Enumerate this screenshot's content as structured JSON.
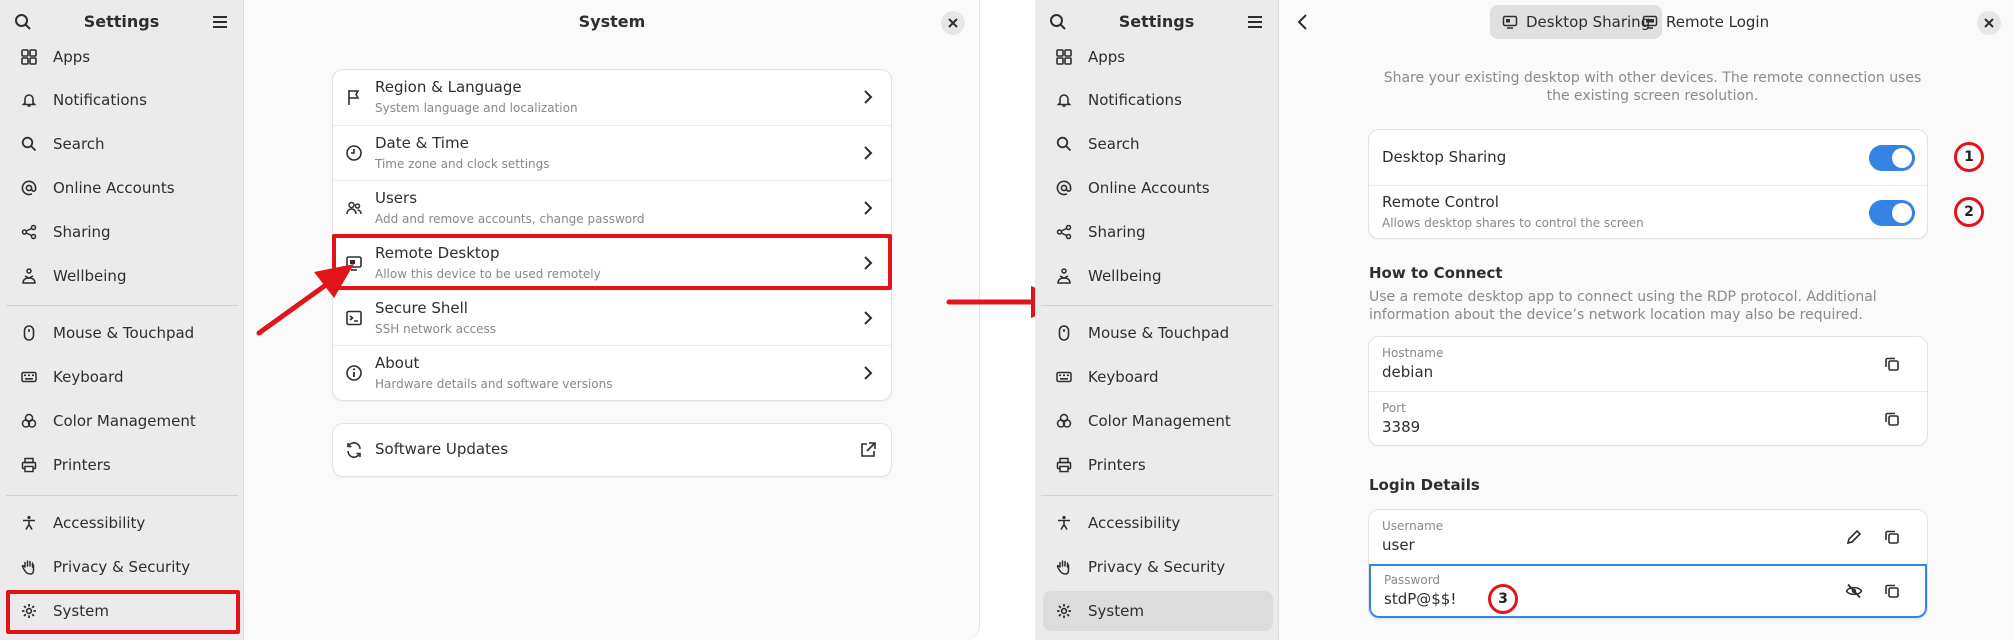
{
  "left_window": {
    "sidebar": {
      "title": "Settings",
      "items": [
        {
          "label": "Apps",
          "icon": "apps-icon"
        },
        {
          "label": "Notifications",
          "icon": "bell-icon"
        },
        {
          "label": "Search",
          "icon": "search-icon"
        },
        {
          "label": "Online Accounts",
          "icon": "at-icon"
        },
        {
          "label": "Sharing",
          "icon": "share-icon"
        },
        {
          "label": "Wellbeing",
          "icon": "wellbeing-icon"
        },
        {
          "label": "Mouse & Touchpad",
          "icon": "mouse-icon"
        },
        {
          "label": "Keyboard",
          "icon": "keyboard-icon"
        },
        {
          "label": "Color Management",
          "icon": "color-icon"
        },
        {
          "label": "Printers",
          "icon": "printer-icon"
        },
        {
          "label": "Accessibility",
          "icon": "accessibility-icon"
        },
        {
          "label": "Privacy & Security",
          "icon": "hand-icon"
        },
        {
          "label": "System",
          "icon": "gear-icon"
        }
      ]
    },
    "page_title": "System",
    "rows": [
      {
        "title": "Region & Language",
        "subtitle": "System language and localization",
        "icon": "flag-icon"
      },
      {
        "title": "Date & Time",
        "subtitle": "Time zone and clock settings",
        "icon": "clock-icon"
      },
      {
        "title": "Users",
        "subtitle": "Add and remove accounts, change password",
        "icon": "users-icon"
      },
      {
        "title": "Remote Desktop",
        "subtitle": "Allow this device to be used remotely",
        "icon": "remote-desktop-icon"
      },
      {
        "title": "Secure Shell",
        "subtitle": "SSH network access",
        "icon": "terminal-icon"
      },
      {
        "title": "About",
        "subtitle": "Hardware details and software versions",
        "icon": "info-icon"
      }
    ],
    "software_updates": "Software Updates"
  },
  "right_window": {
    "sidebar": {
      "title": "Settings",
      "items": [
        {
          "label": "Apps"
        },
        {
          "label": "Notifications"
        },
        {
          "label": "Search"
        },
        {
          "label": "Online Accounts"
        },
        {
          "label": "Sharing"
        },
        {
          "label": "Wellbeing"
        },
        {
          "label": "Mouse & Touchpad"
        },
        {
          "label": "Keyboard"
        },
        {
          "label": "Color Management"
        },
        {
          "label": "Printers"
        },
        {
          "label": "Accessibility"
        },
        {
          "label": "Privacy & Security"
        },
        {
          "label": "System"
        }
      ]
    },
    "tabs": [
      {
        "label": "Desktop Sharing"
      },
      {
        "label": "Remote Login"
      }
    ],
    "description": "Share your existing desktop with other devices. The remote connection uses the existing screen resolution.",
    "desktop_sharing": "Desktop Sharing",
    "remote_control": "Remote Control",
    "remote_control_sub": "Allows desktop shares to control the screen",
    "how_to_connect": "How to Connect",
    "how_desc": "Use a remote desktop app to connect using the RDP protocol. Additional information about the device’s network location may also be required.",
    "hostname_label": "Hostname",
    "hostname_value": "debian",
    "port_label": "Port",
    "port_value": "3389",
    "login_details": "Login Details",
    "username_label": "Username",
    "username_value": "user",
    "password_label": "Password",
    "password_value": "stdP@$$!"
  },
  "annotations": {
    "badge1": "1",
    "badge2": "2",
    "badge3": "3"
  },
  "colors": {
    "accent": "#3584e4",
    "annotation_red": "#e2141b"
  }
}
